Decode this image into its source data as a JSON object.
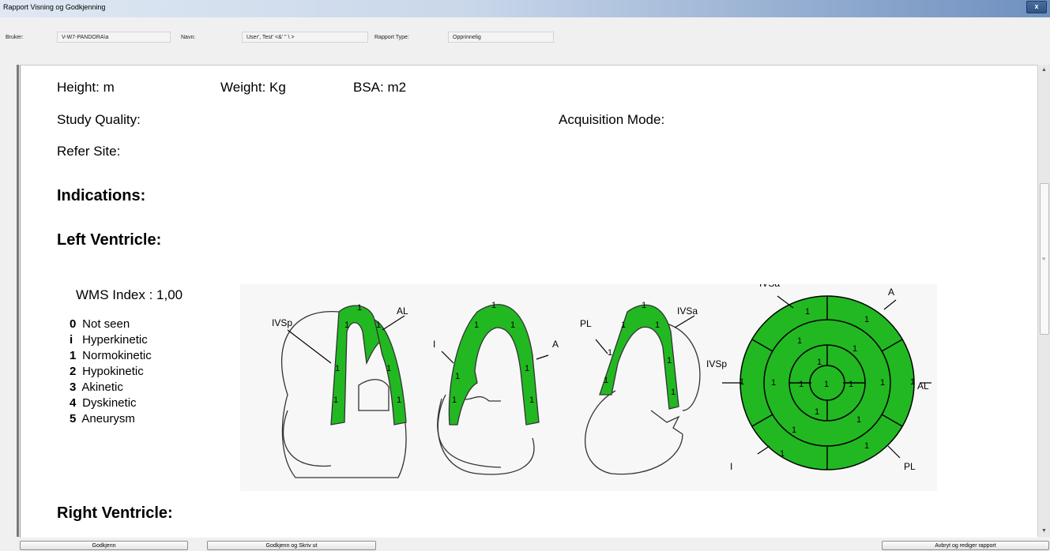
{
  "window": {
    "title": "Rapport Visning og Godkjenning",
    "close_label": "x"
  },
  "header": {
    "user_label": "Bruker:",
    "user_value": "V-W7-PANDORA\\a",
    "name_label": "Navn:",
    "name_value": "User', Test' <&' \" \\ >",
    "type_label": "Rapport Type:",
    "type_value": "Opprinnelig"
  },
  "report": {
    "height": "Height:  m",
    "weight": "Weight:  Kg",
    "bsa": "BSA:   m2",
    "study_quality": "Study Quality:",
    "acquisition_mode": "Acquisition Mode:",
    "refer_site": "Refer Site:",
    "indications": "Indications:",
    "left_ventricle": "Left Ventricle:",
    "right_ventricle": "Right Ventricle:",
    "wms_index": "WMS Index : 1,00",
    "legend": [
      {
        "code": "0",
        "label": "Not seen"
      },
      {
        "code": "i",
        "label": "Hyperkinetic"
      },
      {
        "code": "1",
        "label": "Normokinetic"
      },
      {
        "code": "2",
        "label": "Hypokinetic"
      },
      {
        "code": "3",
        "label": "Akinetic"
      },
      {
        "code": "4",
        "label": "Dyskinetic"
      },
      {
        "code": "5",
        "label": "Aneurysm"
      }
    ],
    "diagram_labels": {
      "ivsp": "IVSp",
      "al": "AL",
      "i": "I",
      "a": "A",
      "pl": "PL",
      "ivsa": "IVSa"
    },
    "segment_score": "1",
    "segment_color": "#22b822"
  },
  "footer": {
    "approve": "Godkjenn",
    "approve_print": "Godkjenn og Skriv ut",
    "cancel_edit": "Avbryt og rediger rapport"
  }
}
